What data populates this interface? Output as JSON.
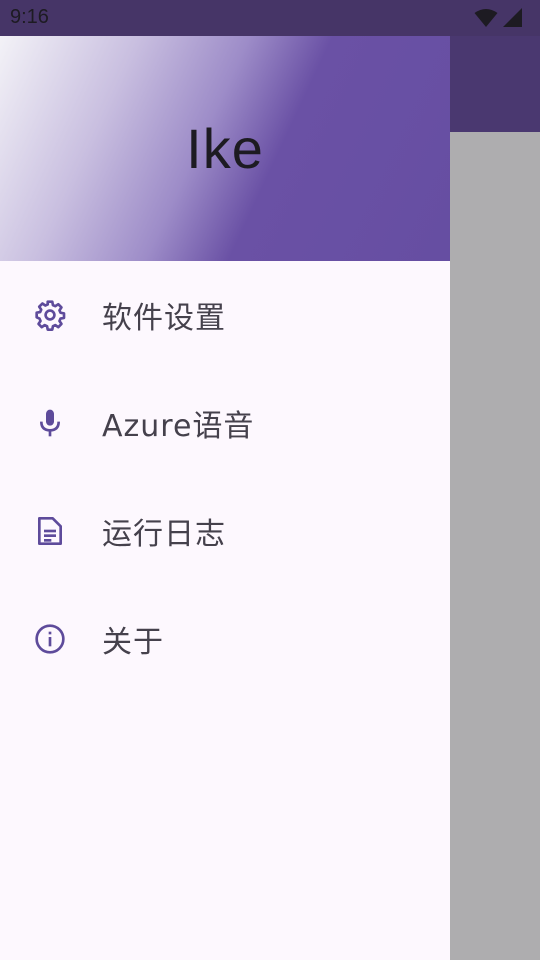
{
  "status_bar": {
    "time": "9:16",
    "icons": [
      "wifi-icon",
      "cellular-signal-icon"
    ]
  },
  "drawer": {
    "header_title": "Ike",
    "items": [
      {
        "label": "软件设置",
        "icon": "gear-icon"
      },
      {
        "label": "Azure语音",
        "icon": "microphone-icon"
      },
      {
        "label": "运行日志",
        "icon": "document-icon"
      },
      {
        "label": "关于",
        "icon": "info-icon"
      }
    ]
  },
  "colors": {
    "accent": "#5e4b9b",
    "drawer_background": "#fdf8fe",
    "scrim": "#aeadaf",
    "status_bar": "#463567",
    "text": "#45414c"
  }
}
